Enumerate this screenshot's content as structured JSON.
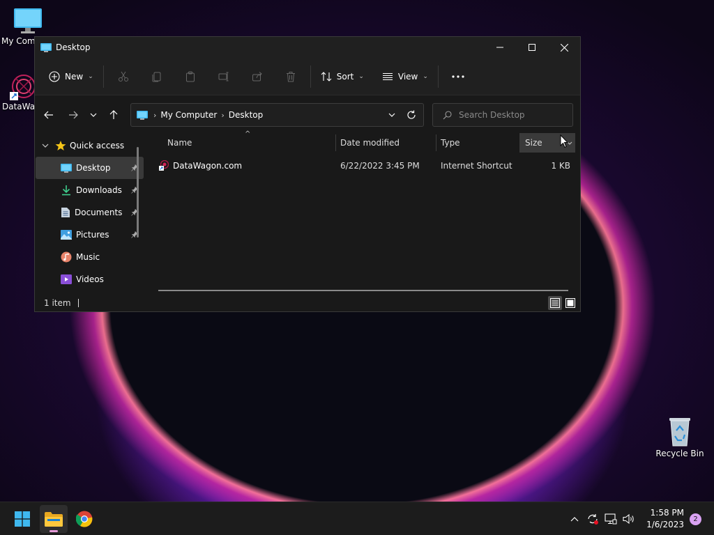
{
  "desktop": {
    "icons": [
      {
        "label": "My Com"
      },
      {
        "label": "DataWag"
      },
      {
        "label": "Recycle Bin"
      }
    ]
  },
  "window": {
    "title": "Desktop",
    "toolbar": {
      "new_label": "New",
      "sort_label": "Sort",
      "view_label": "View"
    },
    "address": {
      "crumbs": [
        "My Computer",
        "Desktop"
      ]
    },
    "search": {
      "placeholder": "Search Desktop"
    },
    "nav": {
      "quick_access": "Quick access",
      "items": [
        {
          "label": "Desktop",
          "pinned": true,
          "selected": true
        },
        {
          "label": "Downloads",
          "pinned": true
        },
        {
          "label": "Documents",
          "pinned": true
        },
        {
          "label": "Pictures",
          "pinned": true
        },
        {
          "label": "Music",
          "pinned": false
        },
        {
          "label": "Videos",
          "pinned": false
        }
      ]
    },
    "columns": {
      "name": "Name",
      "date": "Date modified",
      "type": "Type",
      "size": "Size"
    },
    "files": [
      {
        "name": "DataWagon.com",
        "date": "6/22/2022 3:45 PM",
        "type": "Internet Shortcut",
        "size": "1 KB"
      }
    ],
    "status": {
      "count": "1 item"
    }
  },
  "taskbar": {
    "time": "1:58 PM",
    "date": "1/6/2023",
    "notifications": "2"
  },
  "colors": {
    "accent": "#4cc2ff",
    "window_bg": "#191919",
    "taskbar_bg": "#1c1c1c"
  }
}
